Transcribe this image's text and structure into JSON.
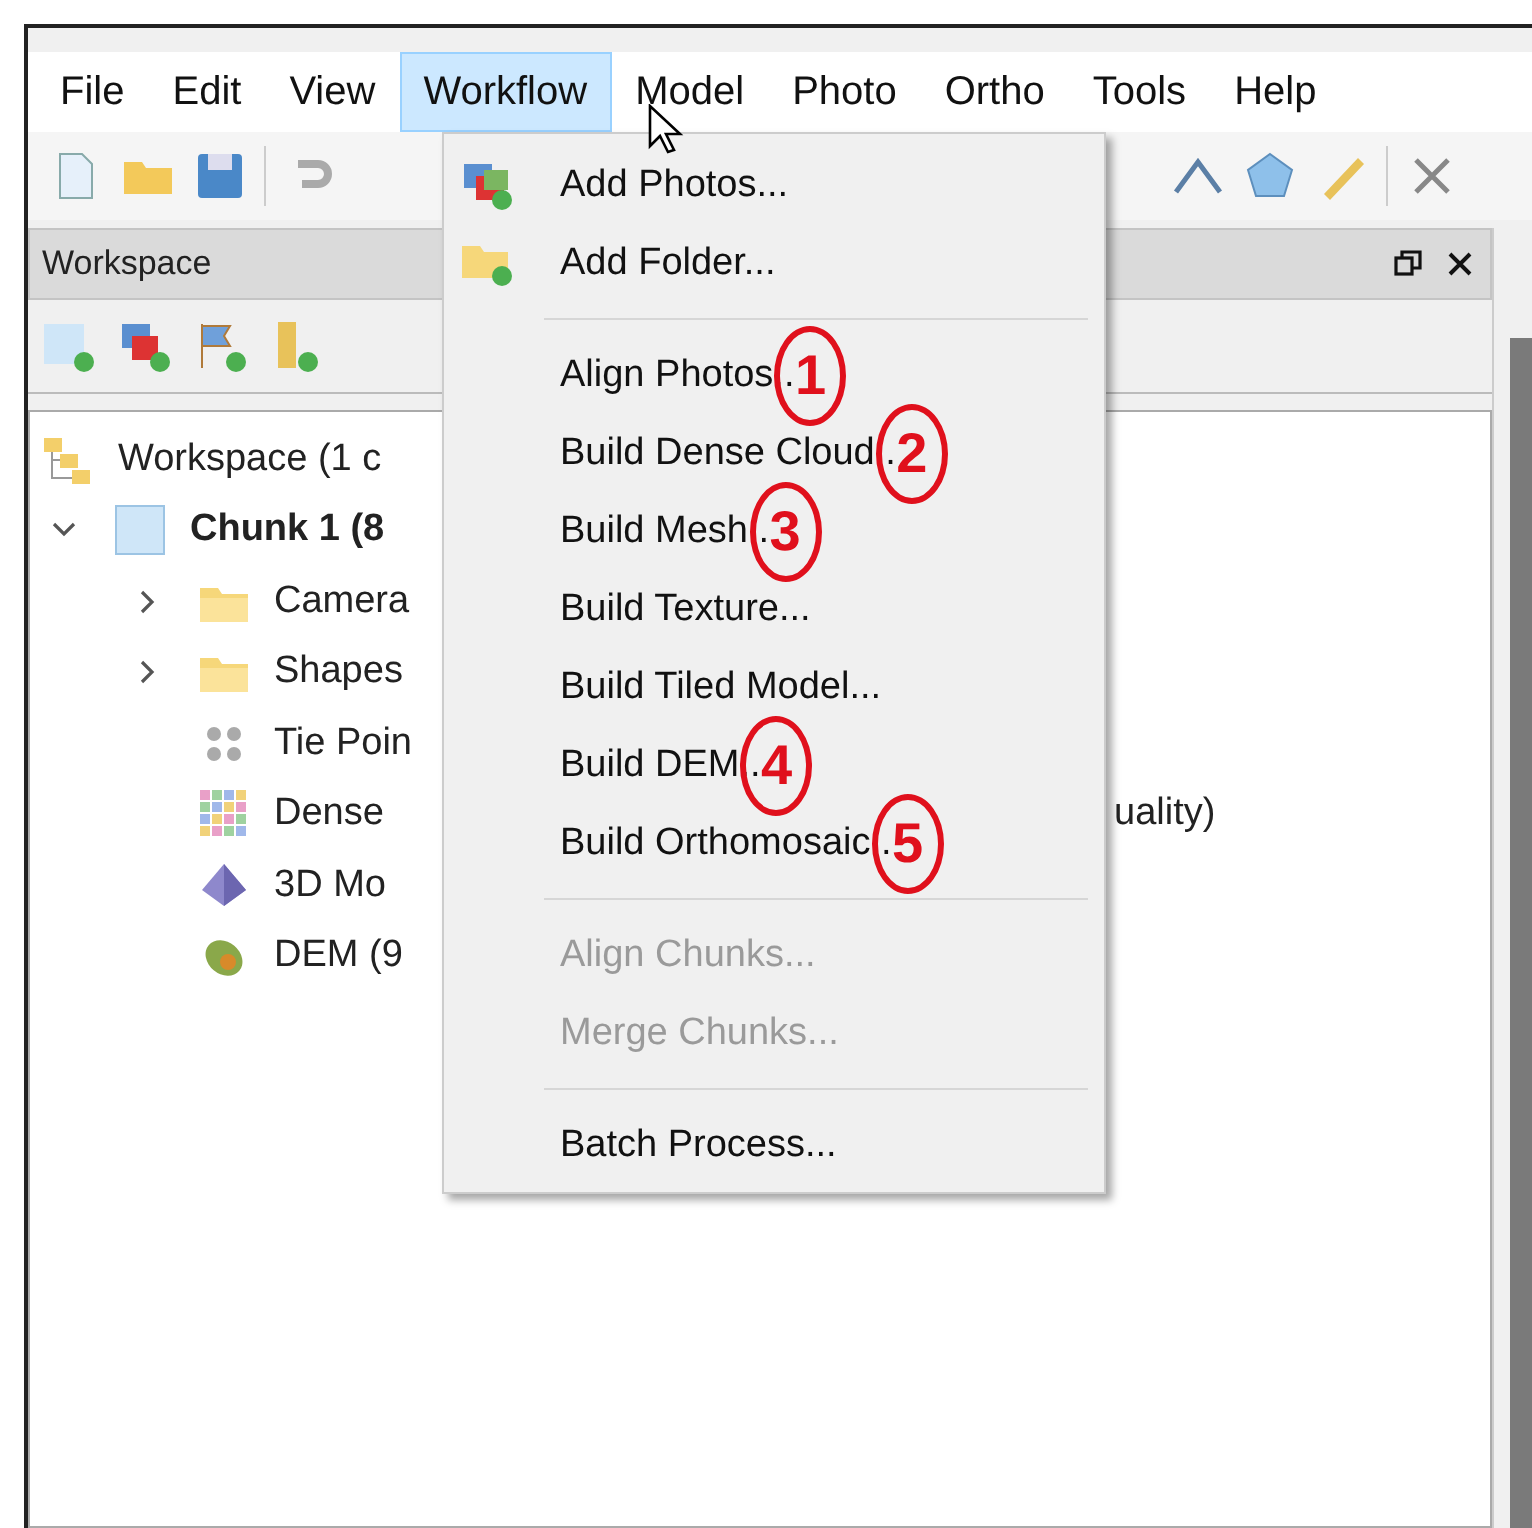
{
  "menu_bar": [
    {
      "label": "File",
      "selected": false
    },
    {
      "label": "Edit",
      "selected": false
    },
    {
      "label": "View",
      "selected": false
    },
    {
      "label": "Workflow",
      "selected": true
    },
    {
      "label": "Model",
      "selected": false
    },
    {
      "label": "Photo",
      "selected": false
    },
    {
      "label": "Ortho",
      "selected": false
    },
    {
      "label": "Tools",
      "selected": false
    },
    {
      "label": "Help",
      "selected": false
    }
  ],
  "workspace_panel": {
    "title": "Workspace",
    "tree": [
      {
        "kind": "workspace",
        "label": "Workspace (1 c",
        "children": [
          {
            "kind": "chunk",
            "label": "Chunk 1 (8",
            "expanded": true,
            "children": [
              {
                "kind": "folder",
                "label": "Camera",
                "expanded": false
              },
              {
                "kind": "folder",
                "label": "Shapes",
                "expanded": false
              },
              {
                "kind": "tie-points",
                "label": "Tie Poin"
              },
              {
                "kind": "dense-cloud",
                "label": "Dense",
                "tail": "uality)"
              },
              {
                "kind": "model",
                "label": "3D Mo"
              },
              {
                "kind": "dem",
                "label": "DEM (9"
              }
            ]
          }
        ]
      }
    ]
  },
  "workflow_menu": [
    {
      "kind": "item",
      "label": "Add Photos...",
      "disabled": false
    },
    {
      "kind": "item",
      "label": "Add Folder...",
      "disabled": false
    },
    {
      "kind": "separator"
    },
    {
      "kind": "item",
      "label": "Align Photos..",
      "disabled": false,
      "annotation": "1"
    },
    {
      "kind": "item",
      "label": "Build Dense Cloud..",
      "disabled": false,
      "annotation": "2"
    },
    {
      "kind": "item",
      "label": "Build Mesh..",
      "disabled": false,
      "annotation": "3"
    },
    {
      "kind": "item",
      "label": "Build Texture...",
      "disabled": false
    },
    {
      "kind": "item",
      "label": "Build Tiled Model...",
      "disabled": false
    },
    {
      "kind": "item",
      "label": "Build DEM..",
      "disabled": false,
      "annotation": "4"
    },
    {
      "kind": "item",
      "label": "Build Orthomosaic..",
      "disabled": false,
      "annotation": "5"
    },
    {
      "kind": "separator"
    },
    {
      "kind": "item",
      "label": "Align Chunks...",
      "disabled": true
    },
    {
      "kind": "item",
      "label": "Merge Chunks...",
      "disabled": true
    },
    {
      "kind": "separator"
    },
    {
      "kind": "item",
      "label": "Batch Process...",
      "disabled": false
    }
  ]
}
